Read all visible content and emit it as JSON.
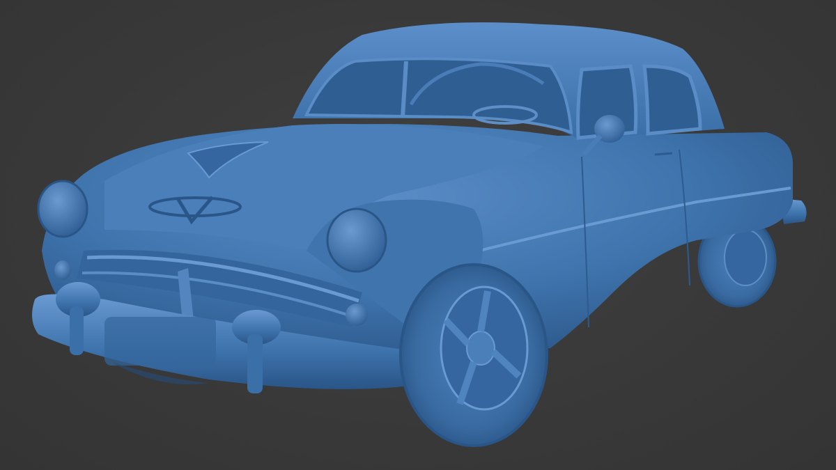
{
  "scene": {
    "subject": "car-model",
    "material_color": "#3f74ad",
    "highlight_color": "#6f9fd6",
    "shadow_color": "#244c7a",
    "background_color": "#3a3a3a"
  }
}
